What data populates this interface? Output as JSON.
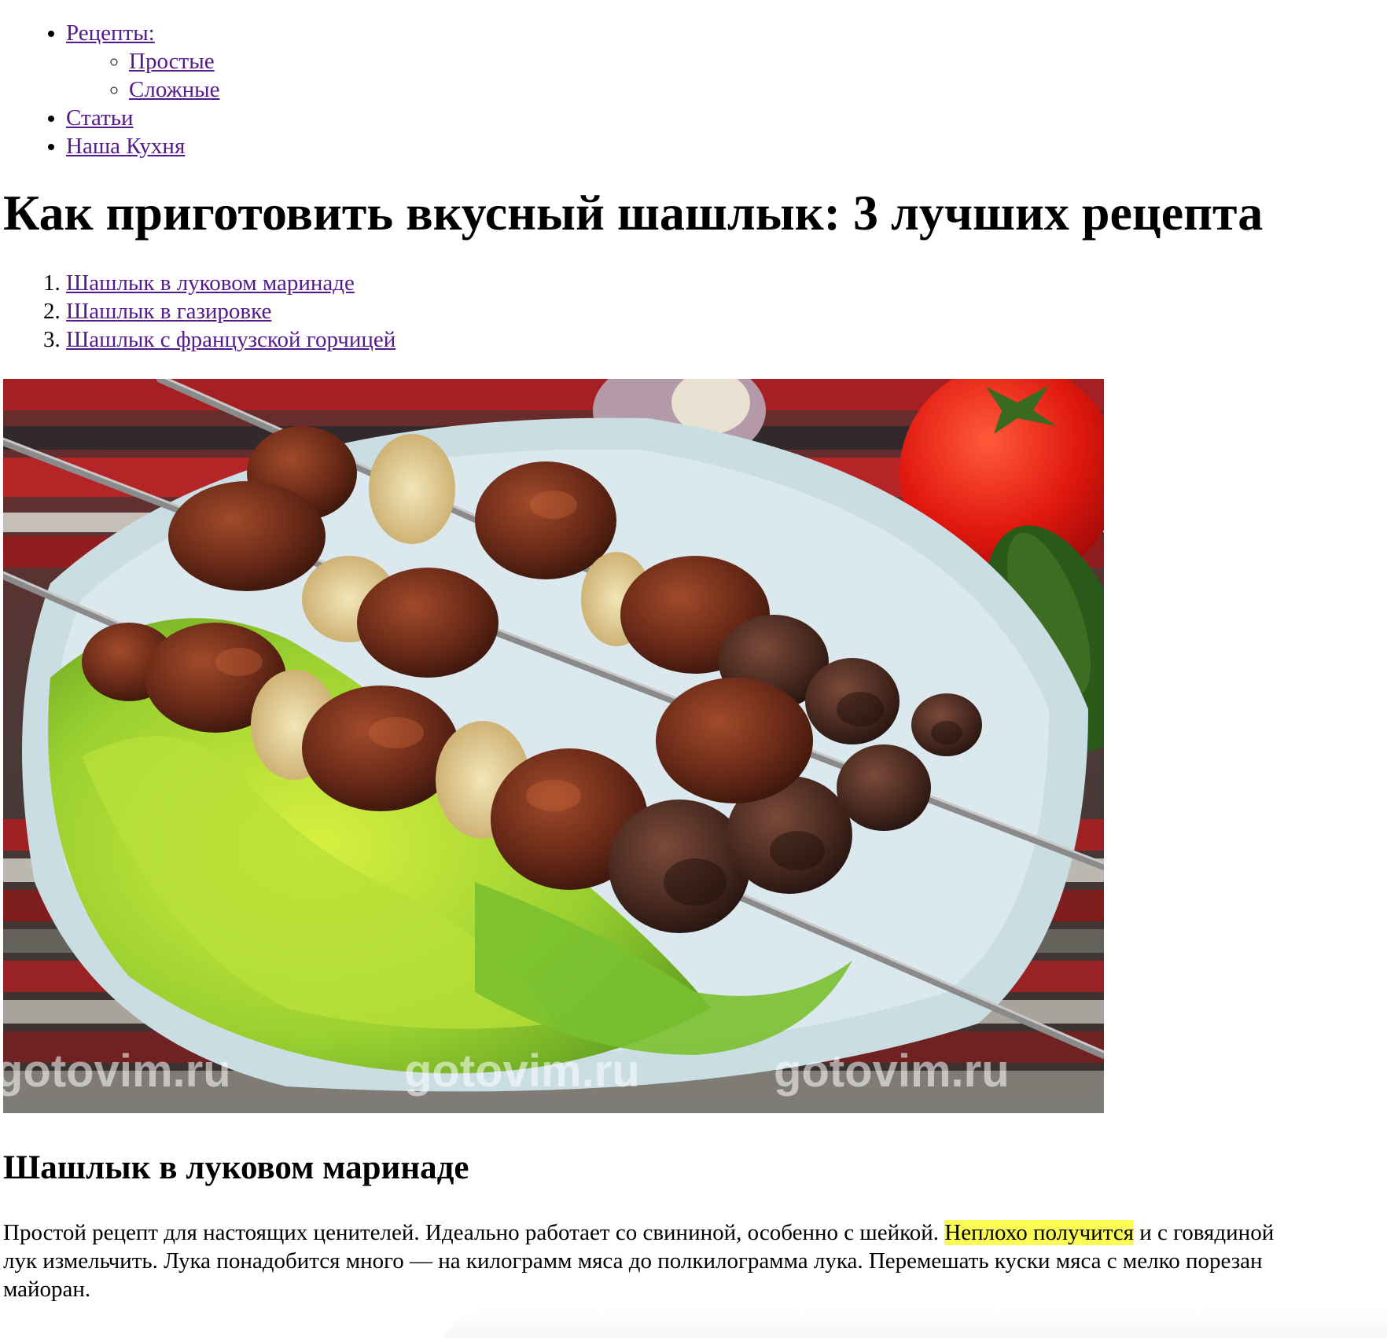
{
  "nav": {
    "items": [
      {
        "label": "Рецепты:",
        "sub": [
          {
            "label": "Простые"
          },
          {
            "label": "Сложные"
          }
        ]
      },
      {
        "label": "Статьи"
      },
      {
        "label": "Наша Кухня"
      }
    ]
  },
  "article": {
    "title": "Как приготовить вкусный шашлык: 3 лучших рецепта",
    "toc": [
      "Шашлык в луковом маринаде",
      "Шашлык в газировке",
      "Шашлык с французской горчицей"
    ],
    "image": {
      "watermark": "gotovim.ru"
    },
    "section1": {
      "title": "Шашлык в луковом маринаде",
      "line1_pre": "Простой рецепт для настоящих ценителей. Идеально работает со свининой, особенно с шейкой. ",
      "line1_highlight": "Неплохо получится",
      "line1_post": " и с говядиной",
      "line2": "лук измельчить. Лука понадобится много — на килограмм мяса до полкилограмма лука. Перемешать куски мяса с мелко порезан",
      "line3": "майоран."
    }
  },
  "colors": {
    "link": "#551a8b",
    "highlight": "#fbfb56"
  }
}
